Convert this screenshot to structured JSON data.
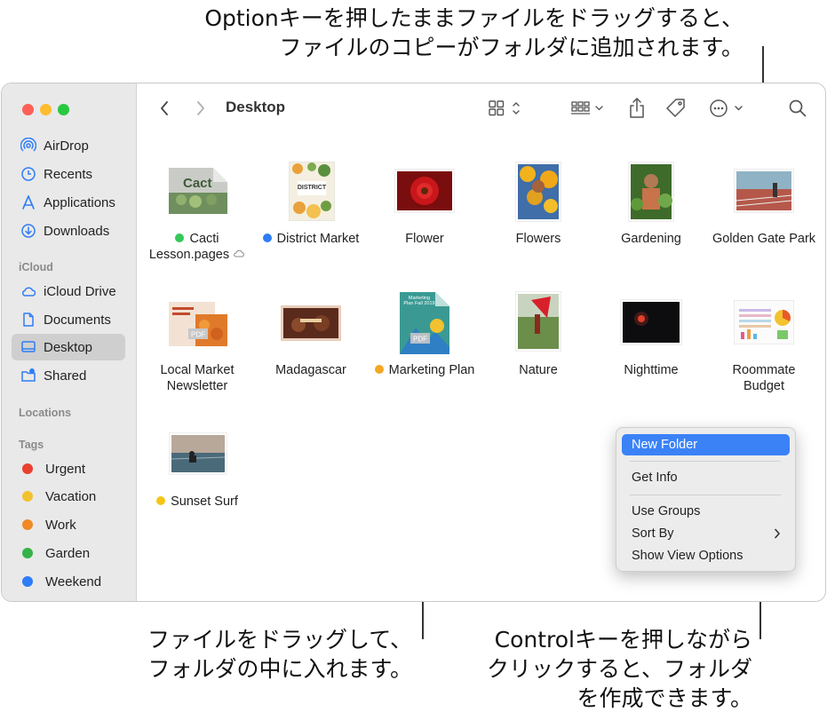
{
  "callouts": {
    "top_line1": "Optionキーを押したままファイルをドラッグすると、",
    "top_line2": "ファイルのコピーがフォルダに追加されます。",
    "bottom_left_line1": "ファイルをドラッグして、",
    "bottom_left_line2": "フォルダの中に入れます。",
    "bottom_right_line1": "Controlキーを押しながら",
    "bottom_right_line2": "クリックすると、フォルダ",
    "bottom_right_line3": "を作成できます。"
  },
  "window": {
    "title": "Desktop"
  },
  "sidebar": {
    "favorites": [
      {
        "label": "AirDrop",
        "icon": "airdrop-icon"
      },
      {
        "label": "Recents",
        "icon": "clock-icon"
      },
      {
        "label": "Applications",
        "icon": "applications-icon"
      },
      {
        "label": "Downloads",
        "icon": "download-icon"
      }
    ],
    "icloud_header": "iCloud",
    "icloud": [
      {
        "label": "iCloud Drive",
        "icon": "cloud-icon"
      },
      {
        "label": "Documents",
        "icon": "document-icon"
      },
      {
        "label": "Desktop",
        "icon": "desktop-icon",
        "selected": true
      },
      {
        "label": "Shared",
        "icon": "shared-folder-icon"
      }
    ],
    "locations_header": "Locations",
    "tags_header": "Tags",
    "tags": [
      {
        "label": "Urgent",
        "color": "#e8412f"
      },
      {
        "label": "Vacation",
        "color": "#f2c12e"
      },
      {
        "label": "Work",
        "color": "#f08a24"
      },
      {
        "label": "Garden",
        "color": "#35b34a"
      },
      {
        "label": "Weekend",
        "color": "#2f7df6"
      }
    ]
  },
  "files": [
    {
      "line1": "Cacti",
      "line2": "Lesson.pages",
      "tag_color": "#35c759"
    },
    {
      "line1": "District Market",
      "line2": "",
      "tag_color": "#2f7df6"
    },
    {
      "line1": "Flower",
      "line2": "",
      "tag_color": ""
    },
    {
      "line1": "Flowers",
      "line2": "",
      "tag_color": ""
    },
    {
      "line1": "Gardening",
      "line2": "",
      "tag_color": ""
    },
    {
      "line1": "Golden Gate Park",
      "line2": "",
      "tag_color": ""
    },
    {
      "line1": "Local Market",
      "line2": "Newsletter",
      "tag_color": ""
    },
    {
      "line1": "Madagascar",
      "line2": "",
      "tag_color": ""
    },
    {
      "line1": "Marketing Plan",
      "line2": "",
      "tag_color": "#f5a623"
    },
    {
      "line1": "Nature",
      "line2": "",
      "tag_color": ""
    },
    {
      "line1": "Nighttime",
      "line2": "",
      "tag_color": ""
    },
    {
      "line1": "Roommate",
      "line2": "Budget",
      "tag_color": ""
    },
    {
      "line1": "Sunset Surf",
      "line2": "",
      "tag_color": "#f5c518"
    }
  ],
  "thumbnail_text": {
    "cacti": "Cact",
    "district": "DISTRICT",
    "pdf": "PDF",
    "marketing_cover": "Marketing Plan Fall 2019"
  },
  "context_menu": {
    "items": [
      "New Folder",
      "Get Info",
      "Use Groups",
      "Sort By",
      "Show View Options"
    ]
  },
  "colors": {
    "accent": "#3b82f7",
    "sidebar_icon": "#2f7df6"
  }
}
